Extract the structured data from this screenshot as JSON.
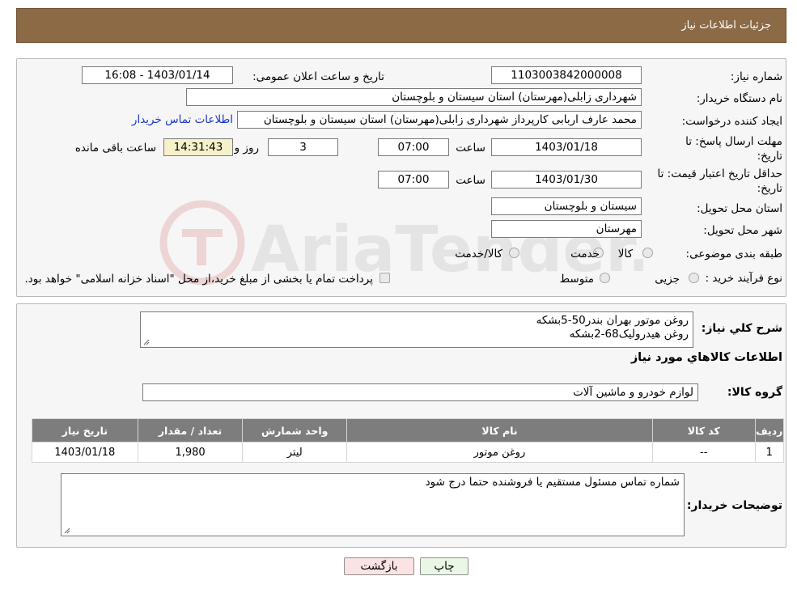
{
  "header": {
    "title": "جزئیات اطلاعات نیاز"
  },
  "fields": {
    "need_number_label": "شماره نیاز:",
    "need_number": "1103003842000008",
    "announce_label": "تاریخ و ساعت اعلان عمومی:",
    "announce_value": "1403/01/14 - 16:08",
    "buyer_org_label": "نام دستگاه خریدار:",
    "buyer_org": "شهرداری زابلی(مهرستان) استان سیستان و بلوچستان",
    "creator_label": "ایجاد کننده درخواست:",
    "creator": "محمد عارف اربابی کارپرداز شهرداری زابلی(مهرستان) استان سیستان و بلوچستان",
    "contact_link": "اطلاعات تماس خریدار",
    "reply_deadline_label": "مهلت ارسال پاسخ: تا تاریخ:",
    "reply_date": "1403/01/18",
    "time_label": "ساعت",
    "reply_time": "07:00",
    "days": "3",
    "days_label": "روز و",
    "remaining": "14:31:43",
    "remaining_label": "ساعت باقی مانده",
    "price_validity_label": "حداقل تاریخ اعتبار قیمت: تا تاریخ:",
    "price_date": "1403/01/30",
    "price_time": "07:00",
    "province_label": "استان محل تحویل:",
    "province": "سیستان و بلوچستان",
    "city_label": "شهر محل تحویل:",
    "city": "مهرستان",
    "category_label": "طبقه بندی موضوعی:",
    "category_options": [
      "کالا",
      "خدمت",
      "کالا/خدمت"
    ],
    "process_label": "نوع فرآیند خرید :",
    "process_options": [
      "جزیی",
      "متوسط"
    ],
    "payment_note": "پرداخت تمام یا بخشی از مبلغ خرید،از محل \"اسناد خزانه اسلامی\" خواهد بود."
  },
  "details": {
    "summary_label": "شرح کلي نياز:",
    "summary_lines": [
      "روغن موتور بهران بندر50-5بشکه",
      "روغن هیدرولیک68-2بشکه"
    ],
    "goods_info_title": "اطلاعات کالاهاي مورد نياز",
    "goods_group_label": "گروه کالا:",
    "goods_group": "لوازم خودرو و ماشین آلات",
    "table": {
      "headers": [
        "رديف",
        "کد کالا",
        "نام کالا",
        "واحد شمارش",
        "تعداد / مقدار",
        "تاریخ نیاز"
      ],
      "rows": [
        [
          "1",
          "--",
          "روغن موتور",
          "لیتر",
          "1,980",
          "1403/01/18"
        ]
      ]
    },
    "buyer_notes_label": "توضیحات خریدار:",
    "buyer_notes": "شماره تماس مسئول مستقیم یا فروشنده حتما درج شود"
  },
  "buttons": {
    "print": "چاپ",
    "back": "بازگشت"
  },
  "watermark": "AriaTender.neT",
  "colors": {
    "header_bg": "#8b6a45",
    "table_header_bg": "#7d7d7d",
    "back_bg": "#fbe3e4",
    "print_bg": "#ebf7e5"
  }
}
